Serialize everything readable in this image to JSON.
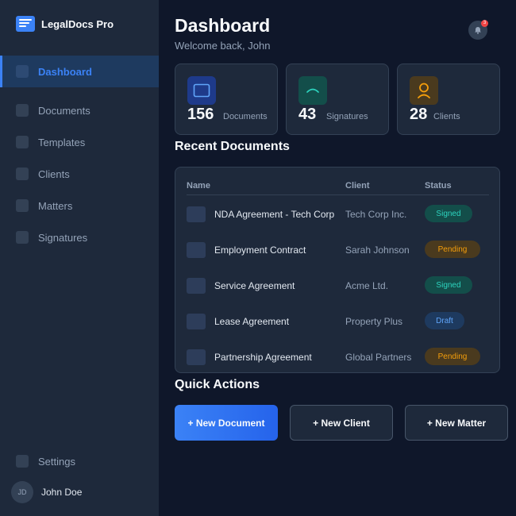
{
  "app": {
    "name": "LegalDocs Pro"
  },
  "colors": {
    "accent": "#3b82f6",
    "signed": "#2dd4bf",
    "pending": "#f59e0b",
    "draft": "#60a5fa",
    "alert": "#ef4444"
  },
  "sidebar": {
    "items": [
      {
        "label": "Dashboard",
        "icon": "dashboard-icon",
        "active": true
      },
      {
        "label": "Documents",
        "icon": "documents-icon"
      },
      {
        "label": "Templates",
        "icon": "templates-icon"
      },
      {
        "label": "Clients",
        "icon": "clients-icon"
      },
      {
        "label": "Matters",
        "icon": "matters-icon"
      },
      {
        "label": "Signatures",
        "icon": "signatures-icon"
      }
    ],
    "settings_label": "Settings",
    "user": {
      "initials": "JD",
      "name": "John Doe"
    }
  },
  "header": {
    "title": "Dashboard",
    "welcome": "Welcome back, John",
    "notifications_count": "3"
  },
  "stats": [
    {
      "value": "156",
      "label": "Documents",
      "icon": "document-icon"
    },
    {
      "value": "43",
      "label": "Signatures",
      "icon": "signature-icon"
    },
    {
      "value": "28",
      "label": "Clients",
      "icon": "user-icon"
    }
  ],
  "recent": {
    "title": "Recent Documents",
    "columns": [
      "Name",
      "Client",
      "Status"
    ],
    "rows": [
      {
        "name": "NDA Agreement - Tech Corp",
        "client": "Tech Corp Inc.",
        "status": "Signed"
      },
      {
        "name": "Employment Contract",
        "client": "Sarah Johnson",
        "status": "Pending"
      },
      {
        "name": "Service Agreement",
        "client": "Acme Ltd.",
        "status": "Signed"
      },
      {
        "name": "Lease Agreement",
        "client": "Property Plus",
        "status": "Draft"
      },
      {
        "name": "Partnership Agreement",
        "client": "Global Partners",
        "status": "Pending"
      }
    ]
  },
  "quick_actions": {
    "title": "Quick Actions",
    "buttons": [
      "+ New Document",
      "+ New Client",
      "+ New Matter"
    ]
  }
}
